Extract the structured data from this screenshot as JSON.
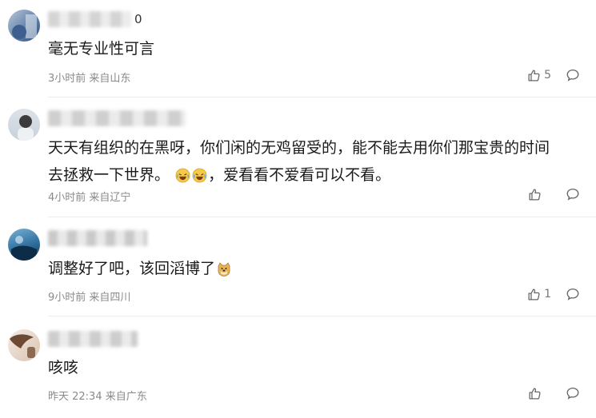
{
  "comments": [
    {
      "name_visible_suffix": "0",
      "text": "毫无专业性可言",
      "meta": "3小时前 来自山东",
      "likes": "5"
    },
    {
      "name_visible_suffix": "",
      "text_line1": "天天有组织的在黑呀，你们闲的无鸡留受的，能不能去用你们那宝贵的时间",
      "text_line2a": "去拯救一下世界。",
      "text_line2b": "，爱看看不爱看可以不看。",
      "meta": "4小时前 来自辽宁",
      "likes": ""
    },
    {
      "name_visible_suffix": "",
      "text": "调整好了吧，该回滔博了",
      "meta": "9小时前 来自四川",
      "likes": "1"
    },
    {
      "name_visible_suffix": "",
      "text": "咳咳",
      "meta": "昨天 22:34 来自广东",
      "likes": ""
    }
  ],
  "icons": {
    "like": "thumbs-up-icon",
    "reply": "comment-bubble-icon",
    "emoji_laugh": "laughing-tears-emoji",
    "emoji_doge": "doge-emoji"
  },
  "colors": {
    "meta_text": "#8a8a8a",
    "divider": "#ececec"
  }
}
